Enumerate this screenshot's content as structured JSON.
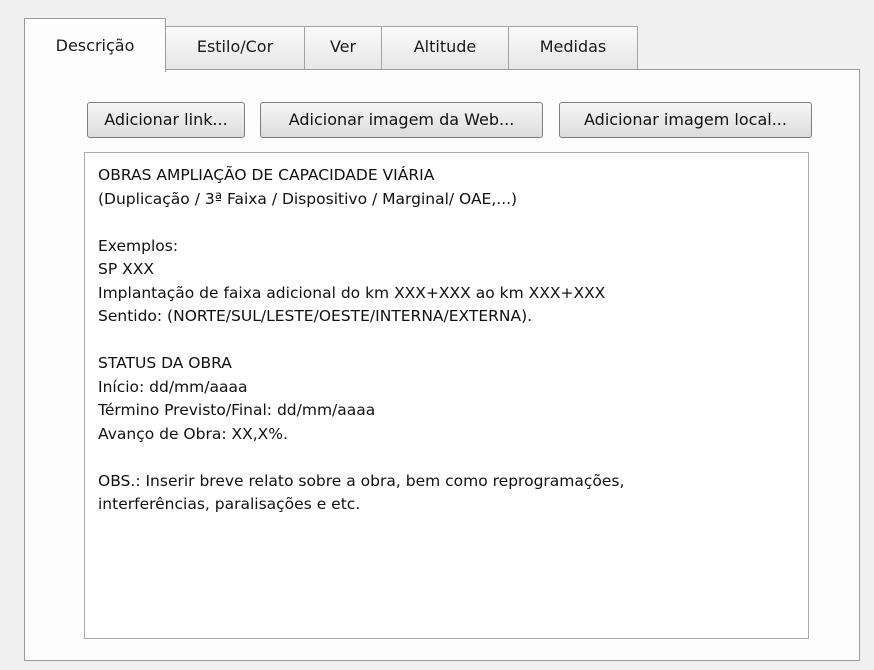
{
  "tabs": [
    {
      "label": "Descrição",
      "active": true
    },
    {
      "label": "Estilo/Cor",
      "active": false
    },
    {
      "label": "Ver",
      "active": false
    },
    {
      "label": "Altitude",
      "active": false
    },
    {
      "label": "Medidas",
      "active": false
    }
  ],
  "toolbar": {
    "add_link_label": "Adicionar link...",
    "add_web_image_label": "Adicionar imagem da Web...",
    "add_local_image_label": "Adicionar imagem local..."
  },
  "description": {
    "lines": [
      "OBRAS AMPLIAÇÃO DE CAPACIDADE VIÁRIA",
      "(Duplicação / 3ª Faixa / Dispositivo / Marginal/ OAE,...)",
      "",
      "Exemplos:",
      "SP XXX",
      "Implantação de faixa adicional do km XXX+XXX ao km XXX+XXX",
      "Sentido: (NORTE/SUL/LESTE/OESTE/INTERNA/EXTERNA).",
      "",
      "STATUS DA OBRA",
      "Início: dd/mm/aaaa",
      "Término Previsto/Final: dd/mm/aaaa",
      "Avanço de Obra: XX,X%.",
      "",
      "OBS.: Inserir breve relato sobre a obra, bem como reprogramações,",
      "interferências, paralisações e etc."
    ]
  }
}
